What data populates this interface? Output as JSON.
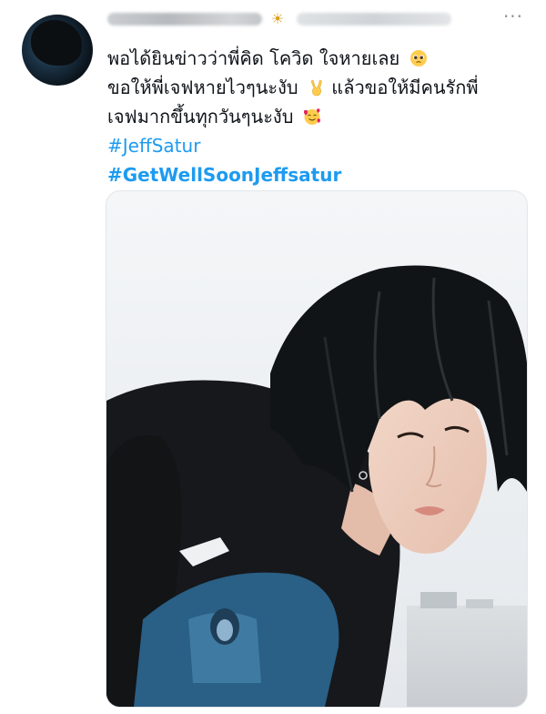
{
  "tweet": {
    "header": {
      "badge_icon": "sun-emoji-icon",
      "more_icon": "more-options-icon"
    },
    "text_lines": [
      "พอได้ยินข่าวว่าพี่คิด โควิด ใจหายเลย",
      "ขอให้พี่เจฟหายไวๆนะงับ",
      "แล้วขอให้มีคนรักพี่",
      "เจฟมากขึ้นทุกวันๆนะงับ"
    ],
    "hashtags": [
      "#JeffSatur",
      "#GetWellSoonJeffsatur"
    ],
    "emojis": [
      "pleading-face-icon",
      "victory-hand-icon",
      "smiling-face-with-hearts-icon"
    ],
    "media": {
      "subject": "photo-young-man-black-tshirt-icon"
    }
  }
}
